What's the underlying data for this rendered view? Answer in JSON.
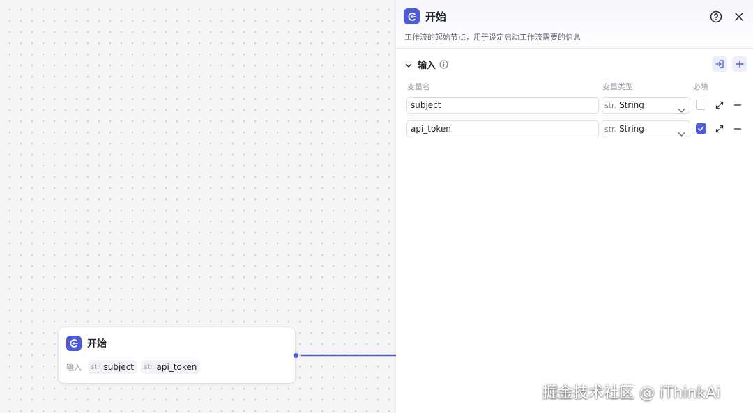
{
  "canvas": {
    "node": {
      "title": "开始",
      "input_label": "输入",
      "inputs": [
        {
          "type": "str.",
          "name": "subject"
        },
        {
          "type": "str.",
          "name": "api_token"
        }
      ]
    }
  },
  "panel": {
    "title": "开始",
    "description": "工作流的起始节点，用于设定启动工作流需要的信息",
    "section_title": "输入",
    "columns": {
      "name": "变量名",
      "type": "变量类型",
      "required": "必填"
    },
    "variables": [
      {
        "name": "subject",
        "type_prefix": "str.",
        "type": "String",
        "required": false
      },
      {
        "name": "api_token",
        "type_prefix": "str.",
        "type": "String",
        "required": true
      }
    ]
  },
  "watermark": "掘金技术社区 @ iThinkAi",
  "icons": {
    "node": "start-node-icon",
    "help": "help-icon",
    "close": "close-icon",
    "collapse": "chevron-down-icon",
    "info": "info-icon",
    "import": "import-icon",
    "add": "plus-icon",
    "expand": "expand-icon",
    "remove": "minus-icon"
  },
  "colors": {
    "accent": "#4e5bd6",
    "edge": "#4e5bd6"
  }
}
